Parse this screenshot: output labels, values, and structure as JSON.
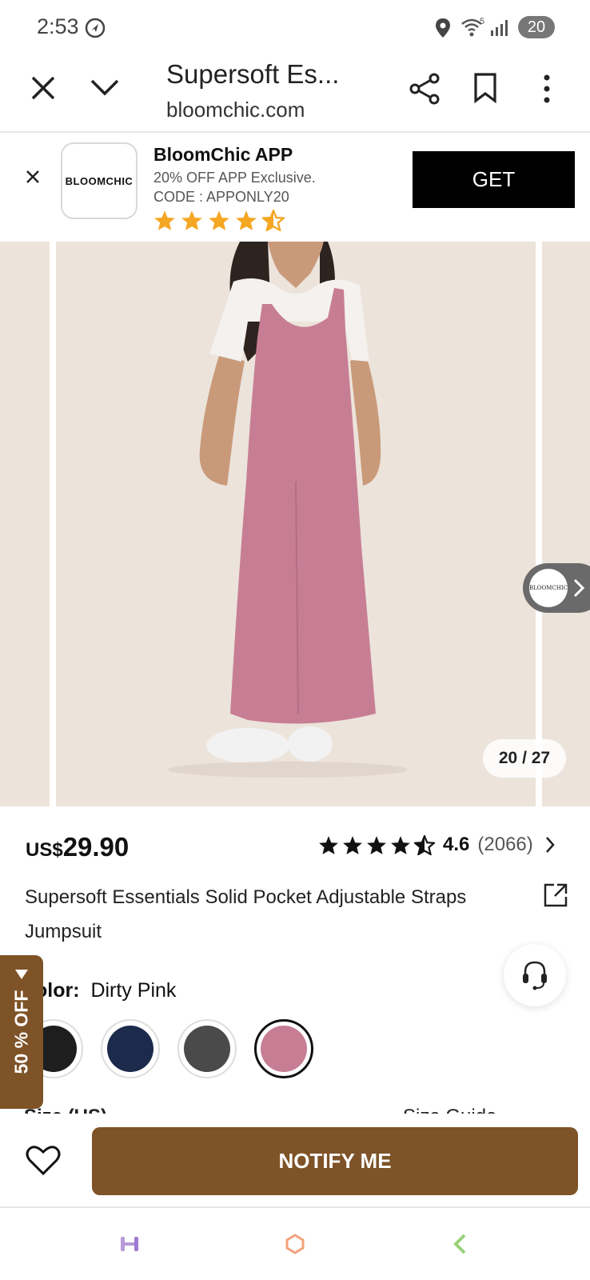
{
  "status_bar": {
    "time": "2:53",
    "battery": "20",
    "wifi_label": "5"
  },
  "toolbar": {
    "title": "Supersoft Es...",
    "url": "bloomchic.com"
  },
  "app_banner": {
    "logo_text": "BLOOMCHIC",
    "app_name": "BloomChic APP",
    "line1": "20% OFF APP Exclusive.",
    "line2": "CODE : APPONLY20",
    "stars": 4.5,
    "get_label": "GET"
  },
  "gallery": {
    "counter": "20 / 27",
    "store_badge": "BLOOMCHIC"
  },
  "product": {
    "currency": "US$",
    "price": "29.90",
    "rating": "4.6",
    "review_count": "(2066)",
    "stars": 4.5,
    "title": "Supersoft Essentials Solid Pocket Adjustable Straps Jumpsuit",
    "color_label": "olor:",
    "color_value": "Dirty Pink",
    "swatches": [
      {
        "color": "#1e1e1e"
      },
      {
        "color": "#1c2a4c"
      },
      {
        "color": "#4a4a4a"
      },
      {
        "color": "#c77e95",
        "selected": true
      }
    ],
    "size_label": "Size (US)",
    "size_guide": "Size Guide"
  },
  "promo_tab": {
    "label": "50 % OFF"
  },
  "action_bar": {
    "notify_label": "NOTIFY ME"
  },
  "colors": {
    "brown": "#7e5328",
    "star": "#f5a623",
    "gallery_bg": "#ece3db",
    "dress": "#c77e95"
  }
}
